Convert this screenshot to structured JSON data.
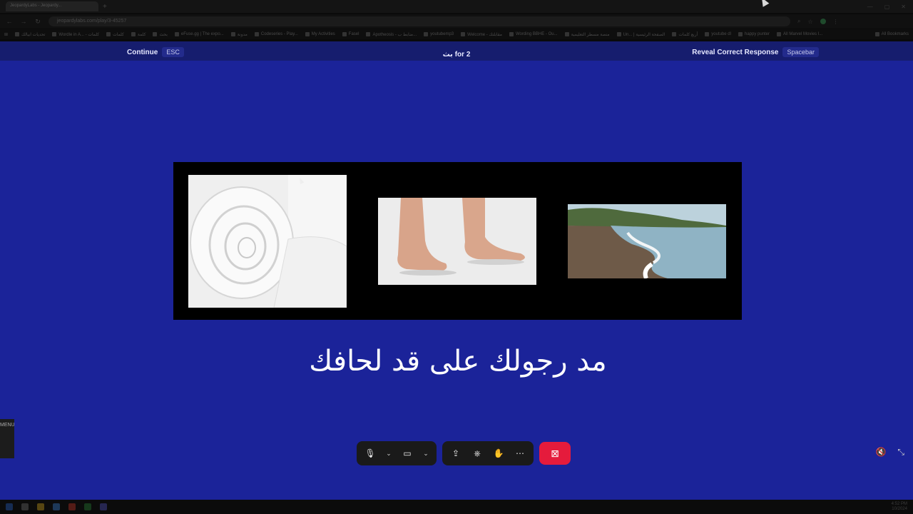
{
  "browser": {
    "tab_title": "JeopardyLabs - Jeopardy...",
    "url": "jeopardylabs.com/play/3-45257",
    "bookmarks": [
      "تحديات ابيالك",
      "Wordle in A... - كلمات",
      "كلمات",
      "كلمة",
      "بحث",
      "eFuse.gg | The expo...",
      "مدونة",
      "Codeseries - Play...",
      "My Activities",
      "Fasel",
      "Apotheosis - ضابط ب...",
      "youtubemp3",
      "Welcome - مقابلتك",
      "Wording BBHE - Ou...",
      "منصة مسطر التعليمية",
      "Un... | الصفحة الرئيسية",
      "أربع كلمات",
      "youtube dl",
      "happy punter",
      "All Marvel Movies I..."
    ],
    "all_bookmarks": "All Bookmarks"
  },
  "game": {
    "continue_label": "Continue",
    "continue_key": "ESC",
    "category_points": "بث for 2",
    "reveal_label": "Reveal Correct Response",
    "reveal_key": "Spacebar",
    "clue_text": "مد رجولك على قد لحافك",
    "images": [
      {
        "name": "rolled-duvet-image",
        "desc": "rolled white duvet"
      },
      {
        "name": "bare-feet-image",
        "desc": "bare feet on white floor"
      },
      {
        "name": "beach-shore-image",
        "desc": "beach shoreline with waves"
      }
    ]
  },
  "meeting": {
    "side_menu": "MENU",
    "leave_color": "#e51b3c"
  },
  "colors": {
    "app_background": "#1b2399",
    "topbar_background": "#161d6e"
  },
  "taskbar": {
    "time": "4:52 PM",
    "date": "10/2024"
  }
}
